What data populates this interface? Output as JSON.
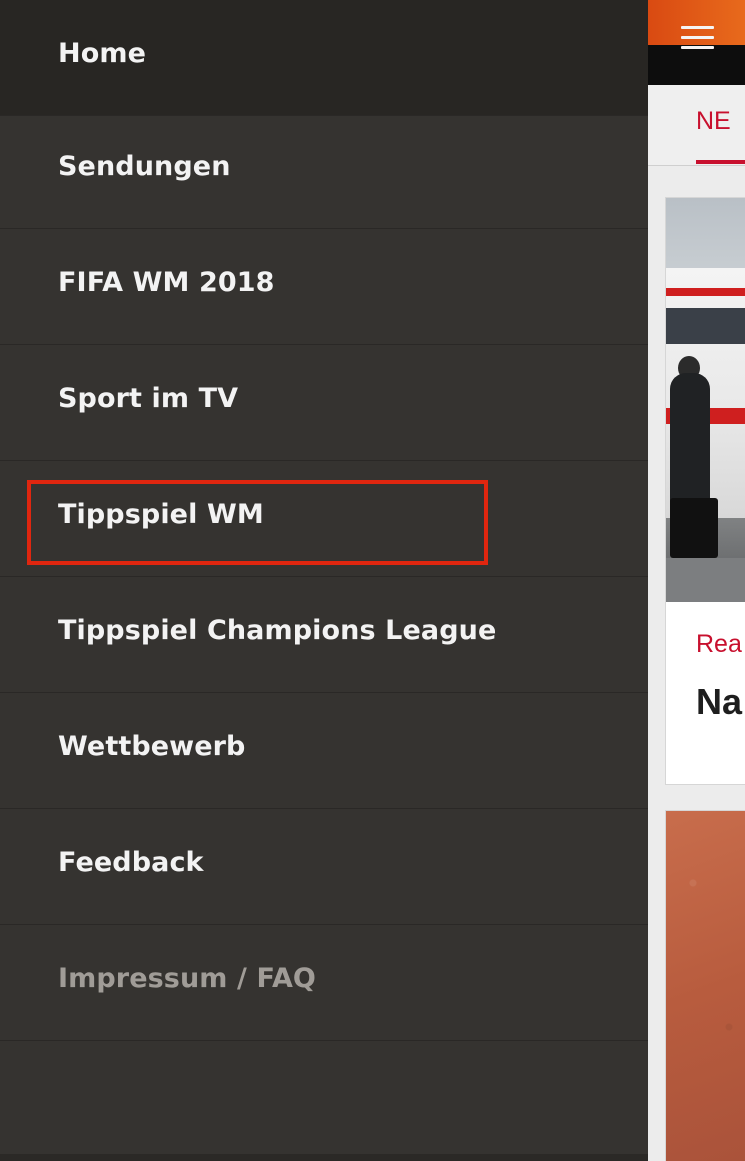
{
  "drawer": {
    "items": [
      {
        "label": "Home",
        "active": true
      },
      {
        "label": "Sendungen"
      },
      {
        "label": "FIFA WM 2018"
      },
      {
        "label": "Sport im TV"
      },
      {
        "label": "Tippspiel WM",
        "highlighted": true
      },
      {
        "label": "Tippspiel Champions League"
      },
      {
        "label": "Wettbewerb"
      },
      {
        "label": "Feedback"
      },
      {
        "label": "Impressum / FAQ",
        "muted": true
      }
    ]
  },
  "app": {
    "active_tab": "NE",
    "card1": {
      "kicker": "Rea",
      "headline": "Na"
    }
  },
  "colors": {
    "drawer_bg": "#353330",
    "active_item_bg": "#282623",
    "highlight_border": "#e0260f",
    "brand_orange": "#e25a16",
    "accent_red": "#c8102e"
  }
}
